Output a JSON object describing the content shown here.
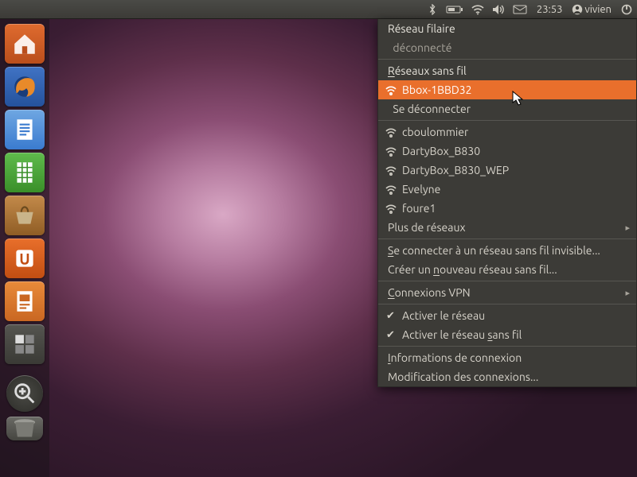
{
  "panel": {
    "time": "23:53",
    "user": "vivien"
  },
  "launcher": [
    {
      "name": "home-folder",
      "color": "home"
    },
    {
      "name": "firefox",
      "color": "web"
    },
    {
      "name": "libreoffice-writer",
      "color": "doc"
    },
    {
      "name": "libreoffice-calc",
      "color": "ss"
    },
    {
      "name": "ubuntu-software-center",
      "color": "soft"
    },
    {
      "name": "ubuntu-one",
      "color": "one"
    },
    {
      "name": "libreoffice-impress",
      "color": "imp"
    },
    {
      "name": "workspace-switcher",
      "color": "work"
    }
  ],
  "menu": {
    "wired_label": "Réseau filaire",
    "wired_status": "déconnecté",
    "wireless_header": "Réseaux sans fil",
    "connected_ssid": "Bbox-1BBD32",
    "disconnect": "Se déconnecter",
    "networks": [
      "cboulommier",
      "DartyBox_B830",
      "DartyBox_B830_WEP",
      "Evelyne",
      "foure1"
    ],
    "more_networks": "Plus de réseaux",
    "connect_hidden": "Se connecter à un réseau sans fil invisible...",
    "create_new": "Créer un nouveau réseau sans fil...",
    "vpn": "Connexions VPN",
    "enable_net": "Activer le réseau",
    "enable_wifi": "Activer le réseau sans fil",
    "conn_info": "Informations de connexion",
    "edit_conn": "Modification des connexions..."
  }
}
